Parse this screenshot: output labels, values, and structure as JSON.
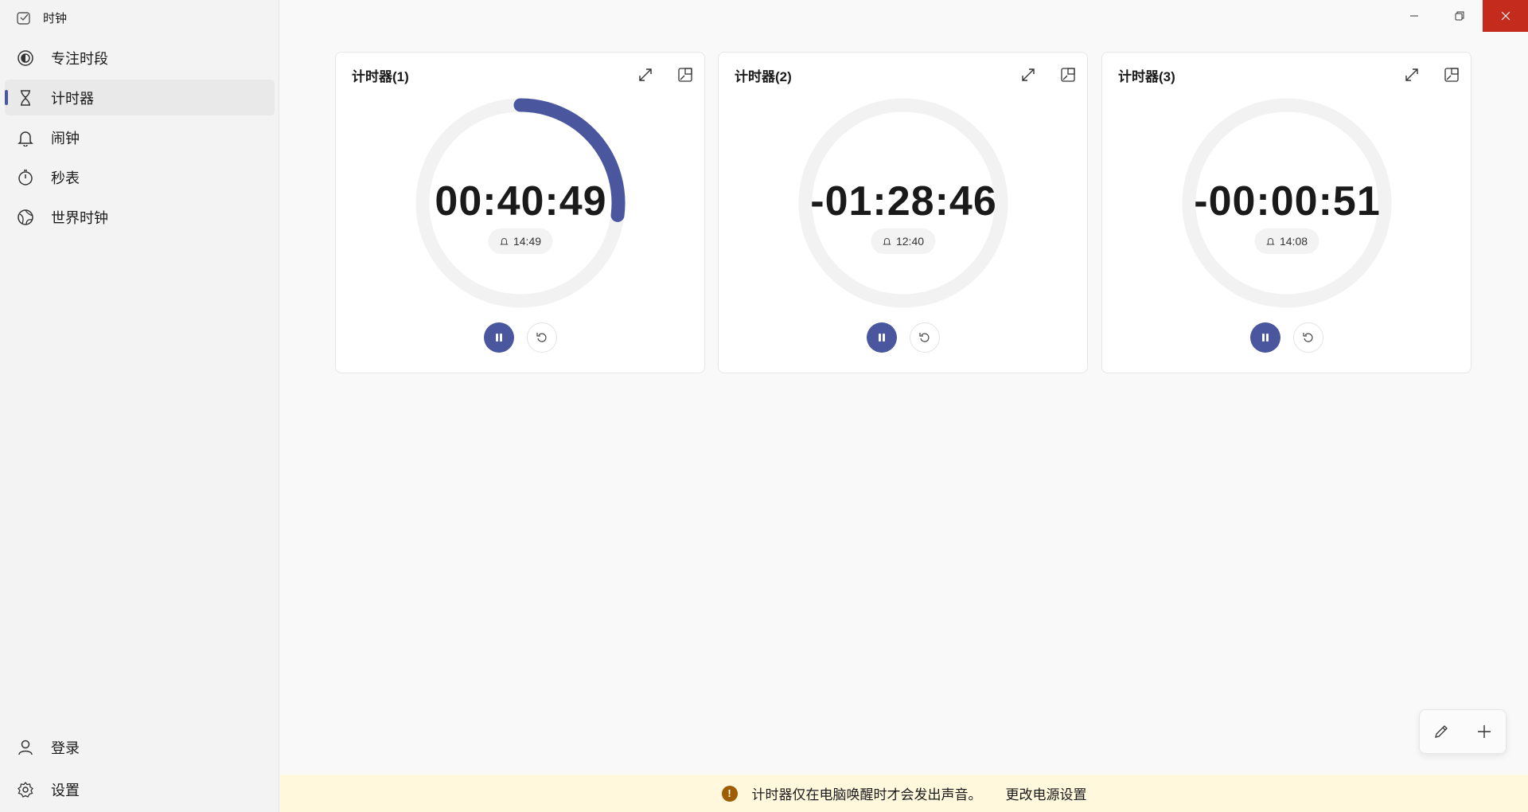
{
  "app": {
    "title": "时钟"
  },
  "window": {
    "minimize_icon": "minimize-icon",
    "restore_icon": "restore-icon",
    "close_icon": "close-icon",
    "close_color": "#c42b1c"
  },
  "sidebar": {
    "items": [
      {
        "label": "专注时段",
        "icon": "focus-icon"
      },
      {
        "label": "计时器",
        "icon": "hourglass-icon",
        "active": true
      },
      {
        "label": "闹钟",
        "icon": "bell-icon"
      },
      {
        "label": "秒表",
        "icon": "stopwatch-icon"
      },
      {
        "label": "世界时钟",
        "icon": "globe-icon"
      }
    ],
    "bottom": [
      {
        "label": "登录",
        "icon": "person-icon"
      },
      {
        "label": "设置",
        "icon": "gear-icon"
      }
    ]
  },
  "accent": "#4a569d",
  "timers": [
    {
      "title": "计时器(1)",
      "time": "00:40:49",
      "alarm": "14:49",
      "progress": 0.27,
      "state": "running"
    },
    {
      "title": "计时器(2)",
      "time": "-01:28:46",
      "alarm": "12:40",
      "progress": 0,
      "state": "running"
    },
    {
      "title": "计时器(3)",
      "time": "-00:00:51",
      "alarm": "14:08",
      "progress": 0,
      "state": "running"
    }
  ],
  "info": {
    "message": "计时器仅在电脑唤醒时才会发出声音。",
    "link": "更改电源设置"
  }
}
